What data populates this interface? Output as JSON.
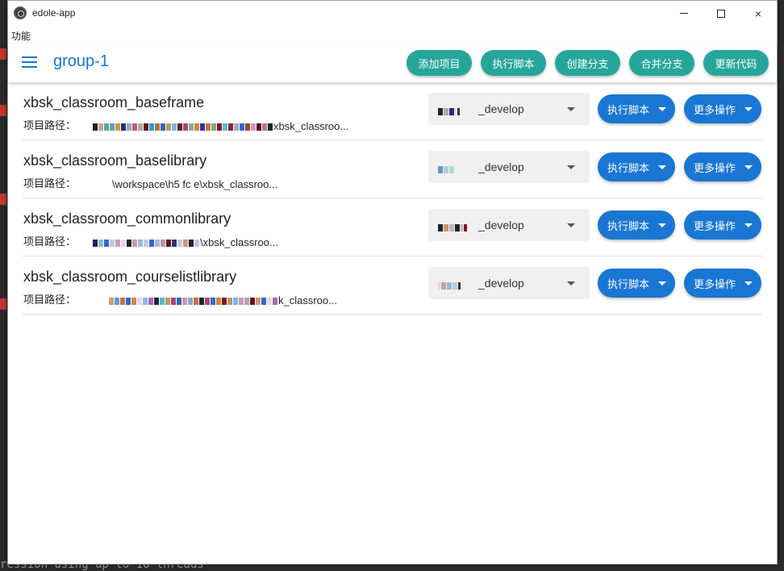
{
  "background_terminal": {
    "visible_text": "ression using up to 16 threads"
  },
  "window": {
    "title": "edole-app",
    "icon": "electron-icon",
    "controls": {
      "minimize": "minimize-icon",
      "maximize": "maximize-icon",
      "close": "×"
    }
  },
  "menubar": {
    "items": [
      "功能"
    ]
  },
  "appbar": {
    "menu_icon": "hamburger-icon",
    "title": "group-1",
    "buttons": [
      "添加项目",
      "执行脚本",
      "创建分支",
      "合并分支",
      "更新代码"
    ]
  },
  "projects": [
    {
      "name": "xbsk_classroom_baseframe",
      "path_label": "项目路径：",
      "path_visible": "xbsk_classroo...",
      "branch_visible": "_develop",
      "run_label": "执行脚本",
      "more_label": "更多操作"
    },
    {
      "name": "xbsk_classroom_baselibrary",
      "path_label": "项目路径：",
      "path_visible": "\\workspace\\h5 fc e\\xbsk_classroo...",
      "branch_visible": "_develop",
      "run_label": "执行脚本",
      "more_label": "更多操作"
    },
    {
      "name": "xbsk_classroom_commonlibrary",
      "path_label": "项目路径：",
      "path_visible": "\\xbsk_classroo...",
      "branch_visible": "_develop",
      "run_label": "执行脚本",
      "more_label": "更多操作"
    },
    {
      "name": "xbsk_classroom_courselistlibrary",
      "path_label": "项目路径：",
      "path_visible": "k_classroo...",
      "branch_visible": "_develop",
      "run_label": "执行脚本",
      "more_label": "更多操作"
    }
  ],
  "colors": {
    "primary": "#1976d2",
    "teal": "#26a69a",
    "select_bg": "#f0f0f0",
    "divider": "#e0e0e0"
  }
}
